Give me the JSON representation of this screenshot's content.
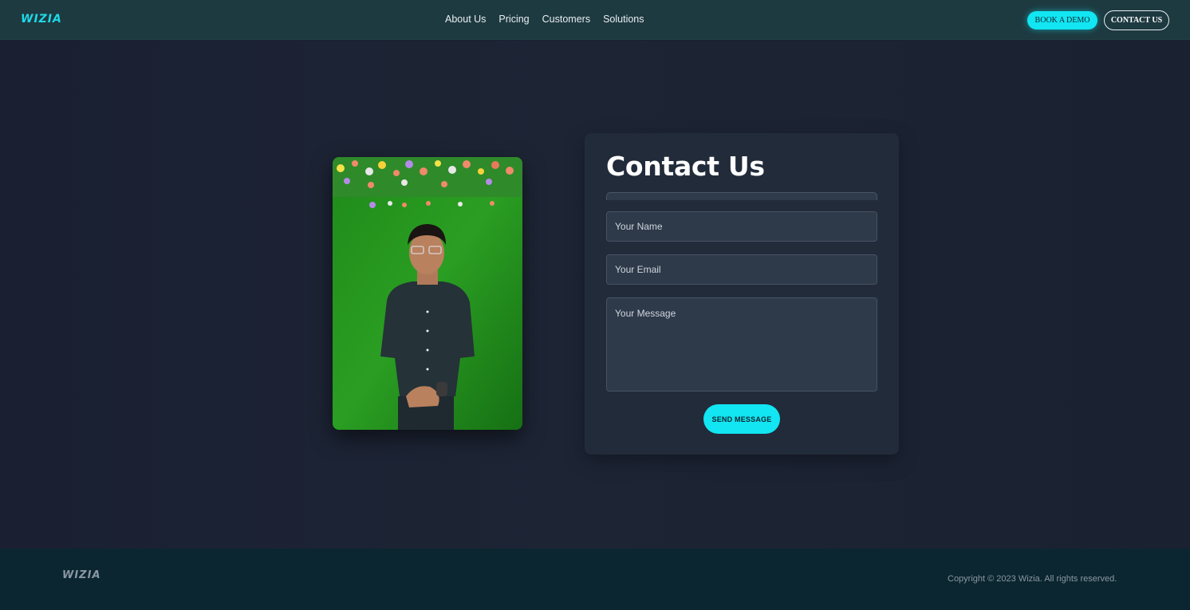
{
  "nav": {
    "logo": "WIZIA",
    "links": [
      "About Us",
      "Pricing",
      "Customers",
      "Solutions"
    ],
    "book_demo_label": "BOOK A DEMO",
    "contact_label": "CONTACT US"
  },
  "contact": {
    "title": "Contact Us",
    "name_placeholder": "Your Name",
    "email_placeholder": "Your Email",
    "message_placeholder": "Your Message",
    "send_label": "SEND MESSAGE"
  },
  "footer": {
    "logo": "WIZIA",
    "copyright": "Copyright © 2023 Wizia. All rights reserved."
  },
  "colors": {
    "accent": "#11e6f2",
    "nav_bg": "#1e3a41",
    "page_bg": "#1a2131",
    "card_bg": "#222b3a",
    "footer_bg": "#0b2630"
  }
}
